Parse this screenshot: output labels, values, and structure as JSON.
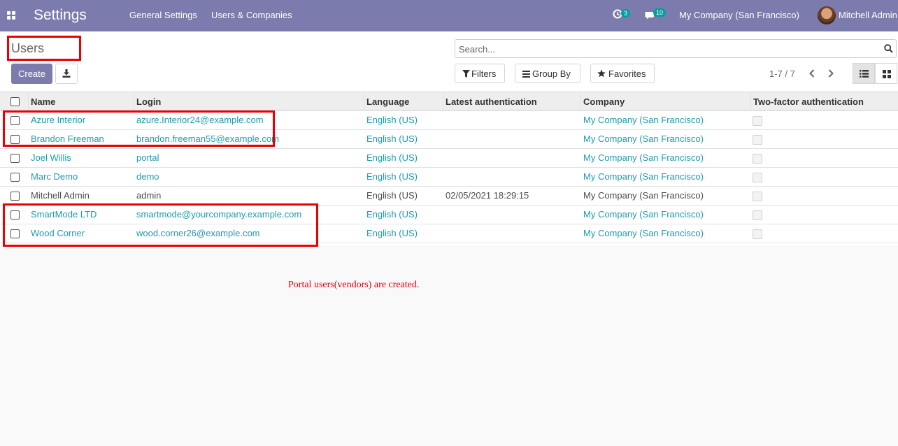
{
  "navbar": {
    "app_title": "Settings",
    "menu": [
      "General Settings",
      "Users & Companies"
    ],
    "activity_count": "3",
    "message_count": "10",
    "company": "My Company (San Francisco)",
    "user": "Mitchell Admin",
    "bg_color": "#7c7bad"
  },
  "control_panel": {
    "title": "Users",
    "create_label": "Create",
    "search_placeholder": "Search...",
    "filters_label": "Filters",
    "groupby_label": "Group By",
    "favorites_label": "Favorites",
    "pager": "1-7 / 7"
  },
  "table": {
    "columns": [
      "Name",
      "Login",
      "Language",
      "Latest authentication",
      "Company",
      "Two-factor authentication"
    ],
    "rows": [
      {
        "name": "Azure Interior",
        "login": "azure.Interior24@example.com",
        "language": "English (US)",
        "latest_auth": "",
        "company": "My Company (San Francisco)"
      },
      {
        "name": "Brandon Freeman",
        "login": "brandon.freeman55@example.com",
        "language": "English (US)",
        "latest_auth": "",
        "company": "My Company (San Francisco)"
      },
      {
        "name": "Joel Willis",
        "login": "portal",
        "language": "English (US)",
        "latest_auth": "",
        "company": "My Company (San Francisco)"
      },
      {
        "name": "Marc Demo",
        "login": "demo",
        "language": "English (US)",
        "latest_auth": "",
        "company": "My Company (San Francisco)"
      },
      {
        "name": "Mitchell Admin",
        "login": "admin",
        "language": "English (US)",
        "latest_auth": "02/05/2021 18:29:15",
        "company": "My Company (San Francisco)"
      },
      {
        "name": "SmartMode LTD",
        "login": "smartmode@yourcompany.example.com",
        "language": "English (US)",
        "latest_auth": "",
        "company": "My Company (San Francisco)"
      },
      {
        "name": "Wood Corner",
        "login": "wood.corner26@example.com",
        "language": "English (US)",
        "latest_auth": "",
        "company": "My Company (San Francisco)"
      }
    ]
  },
  "annotation": {
    "caption": "Portal users(vendors) are created.",
    "highlight_color": "#ea0000"
  },
  "colors": {
    "link": "#1f9bad",
    "badge": "#00a09d"
  }
}
